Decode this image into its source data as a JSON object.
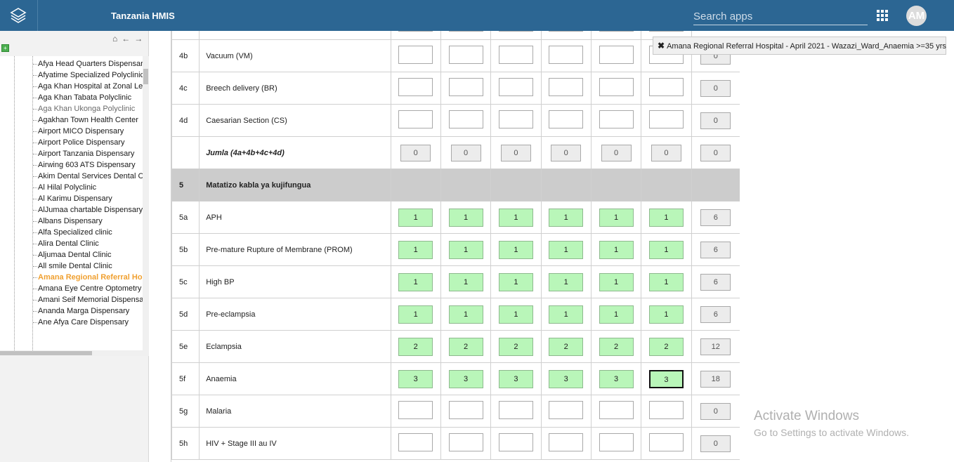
{
  "header": {
    "title": "Tanzania HMIS",
    "search_placeholder": "Search apps",
    "avatar_initials": "AM"
  },
  "sidebar": {
    "nav_icons": [
      "home-icon",
      "arrow-left-icon",
      "arrow-right-icon"
    ],
    "org_units": [
      {
        "name": "Afya Head Quarters Dispensary",
        "state": "normal"
      },
      {
        "name": "Afyatime Specialized Polyclinic",
        "state": "normal"
      },
      {
        "name": "Aga Khan Hospital at Zonal Level",
        "state": "normal"
      },
      {
        "name": "Aga Khan Tabata Polyclinic",
        "state": "normal"
      },
      {
        "name": "Aga Khan Ukonga Polyclinic",
        "state": "muted"
      },
      {
        "name": "Agakhan Town Health Center",
        "state": "normal"
      },
      {
        "name": "Airport MICO Dispensary",
        "state": "normal"
      },
      {
        "name": "Airport Police Dispensary",
        "state": "normal"
      },
      {
        "name": "Airport Tanzania Dispensary",
        "state": "normal"
      },
      {
        "name": "Airwing 603 ATS Dispensary",
        "state": "normal"
      },
      {
        "name": "Akim Dental Services Dental Clinic",
        "state": "normal"
      },
      {
        "name": "Al Hilal Polyclinic",
        "state": "normal"
      },
      {
        "name": "Al Karimu Dispensary",
        "state": "normal"
      },
      {
        "name": "AlJumaa chartable Dispensary",
        "state": "normal"
      },
      {
        "name": "Albans Dispensary",
        "state": "normal"
      },
      {
        "name": "Alfa Specialized clinic",
        "state": "normal"
      },
      {
        "name": "Alira Dental Clinic",
        "state": "normal"
      },
      {
        "name": "Aljumaa Dental Clinic",
        "state": "normal"
      },
      {
        "name": "All smile Dental Clinic",
        "state": "normal"
      },
      {
        "name": "Amana Regional Referral Hospital",
        "state": "active"
      },
      {
        "name": "Amana Eye Centre Optometry Clinic",
        "state": "normal"
      },
      {
        "name": "Amani Seif Memorial Dispensary",
        "state": "normal"
      },
      {
        "name": "Ananda Marga Dispensary",
        "state": "normal"
      },
      {
        "name": "Ane Afya Care Dispensary",
        "state": "normal"
      }
    ]
  },
  "form": {
    "rows": [
      {
        "code": "",
        "label": "",
        "type": "partial",
        "values": [
          "",
          "",
          "",
          "",
          "",
          ""
        ],
        "total": ""
      },
      {
        "code": "4b",
        "label": "Vacuum (VM)",
        "type": "input",
        "values": [
          "",
          "",
          "",
          "",
          "",
          ""
        ],
        "total": "0"
      },
      {
        "code": "4c",
        "label": "Breech delivery (BR)",
        "type": "input",
        "values": [
          "",
          "",
          "",
          "",
          "",
          ""
        ],
        "total": "0"
      },
      {
        "code": "4d",
        "label": "Caesarian Section (CS)",
        "type": "input",
        "values": [
          "",
          "",
          "",
          "",
          "",
          ""
        ],
        "total": "0"
      },
      {
        "code": "",
        "label": "Jumla (4a+4b+4c+4d)",
        "type": "sum",
        "values": [
          "0",
          "0",
          "0",
          "0",
          "0",
          "0"
        ],
        "total": "0"
      },
      {
        "code": "5",
        "label": "Matatizo kabla ya kujifungua",
        "type": "section",
        "values": [],
        "total": ""
      },
      {
        "code": "5a",
        "label": "APH",
        "type": "input",
        "values": [
          "1",
          "1",
          "1",
          "1",
          "1",
          "1"
        ],
        "total": "6"
      },
      {
        "code": "5b",
        "label": "Pre-mature Rupture of Membrane (PROM)",
        "type": "input",
        "values": [
          "1",
          "1",
          "1",
          "1",
          "1",
          "1"
        ],
        "total": "6"
      },
      {
        "code": "5c",
        "label": "High BP",
        "type": "input",
        "values": [
          "1",
          "1",
          "1",
          "1",
          "1",
          "1"
        ],
        "total": "6"
      },
      {
        "code": "5d",
        "label": "Pre-eclampsia",
        "type": "input",
        "values": [
          "1",
          "1",
          "1",
          "1",
          "1",
          "1"
        ],
        "total": "6"
      },
      {
        "code": "5e",
        "label": "Eclampsia",
        "type": "input",
        "values": [
          "2",
          "2",
          "2",
          "2",
          "2",
          "2"
        ],
        "total": "12"
      },
      {
        "code": "5f",
        "label": "Anaemia",
        "type": "input",
        "values": [
          "3",
          "3",
          "3",
          "3",
          "3",
          "3"
        ],
        "total": "18",
        "focused_col": 5
      },
      {
        "code": "5g",
        "label": "Malaria",
        "type": "input",
        "values": [
          "",
          "",
          "",
          "",
          "",
          ""
        ],
        "total": "0"
      },
      {
        "code": "5h",
        "label": "HIV + Stage III au IV",
        "type": "input",
        "values": [
          "",
          "",
          "",
          "",
          "",
          ""
        ],
        "total": "0"
      }
    ]
  },
  "tooltip": {
    "text": "Amana Regional Referral Hospital - April 2021 - Wazazi_Ward_Anaemia >=35 yrs"
  },
  "watermark": {
    "title": "Activate Windows",
    "subtitle": "Go to Settings to activate Windows."
  }
}
